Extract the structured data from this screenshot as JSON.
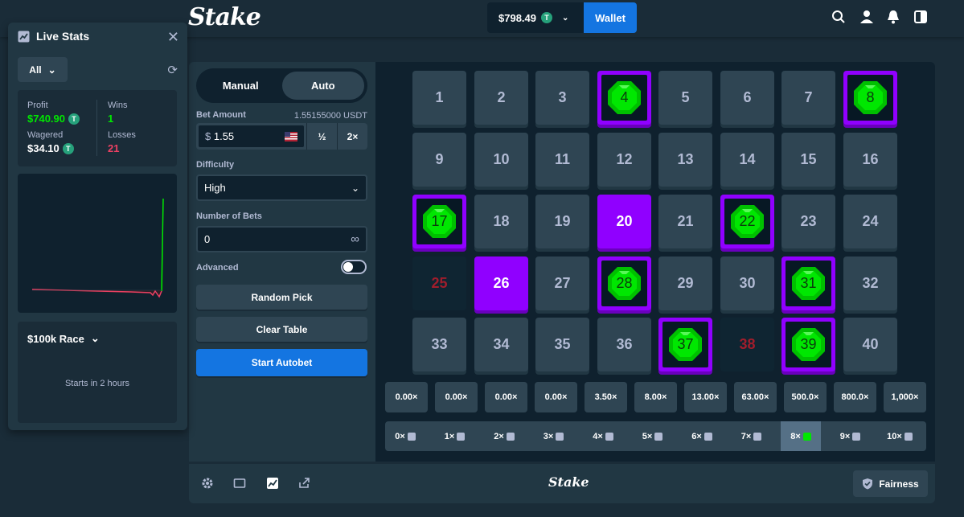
{
  "header": {
    "logo": "Stake",
    "balance": "$798.49",
    "coin": "T",
    "wallet_label": "Wallet",
    "icons": [
      "search-icon",
      "user-icon",
      "notification-icon",
      "sidebar-toggle-icon"
    ]
  },
  "live_stats": {
    "title": "Live Stats",
    "filter": "All",
    "profit_label": "Profit",
    "profit_value": "$740.90",
    "wagered_label": "Wagered",
    "wagered_value": "$34.10",
    "wins_label": "Wins",
    "wins_value": "1",
    "losses_label": "Losses",
    "losses_value": "21",
    "race_title": "$100k Race",
    "race_subtitle": "Starts in 2 hours"
  },
  "controls": {
    "tab_manual": "Manual",
    "tab_auto": "Auto",
    "bet_amount_label": "Bet Amount",
    "bet_amount_crypto": "1.55155000 USDT",
    "bet_currency_symbol": "$",
    "bet_amount_value": "1.55",
    "half_label": "½",
    "double_label": "2×",
    "difficulty_label": "Difficulty",
    "difficulty_value": "High",
    "bets_label": "Number of Bets",
    "bets_value": "0",
    "infinity": "∞",
    "advanced_label": "Advanced",
    "advanced_on": false,
    "random_pick": "Random Pick",
    "clear_table": "Clear Table",
    "start_autobet": "Start Autobet"
  },
  "tiles": [
    {
      "n": "1",
      "state": "idle"
    },
    {
      "n": "2",
      "state": "idle"
    },
    {
      "n": "3",
      "state": "idle"
    },
    {
      "n": "4",
      "state": "gem"
    },
    {
      "n": "5",
      "state": "idle"
    },
    {
      "n": "6",
      "state": "idle"
    },
    {
      "n": "7",
      "state": "idle"
    },
    {
      "n": "8",
      "state": "gem"
    },
    {
      "n": "9",
      "state": "idle"
    },
    {
      "n": "10",
      "state": "idle"
    },
    {
      "n": "11",
      "state": "idle"
    },
    {
      "n": "12",
      "state": "idle"
    },
    {
      "n": "13",
      "state": "idle"
    },
    {
      "n": "14",
      "state": "idle"
    },
    {
      "n": "15",
      "state": "idle"
    },
    {
      "n": "16",
      "state": "idle"
    },
    {
      "n": "17",
      "state": "gem"
    },
    {
      "n": "18",
      "state": "idle"
    },
    {
      "n": "19",
      "state": "idle"
    },
    {
      "n": "20",
      "state": "picked"
    },
    {
      "n": "21",
      "state": "idle"
    },
    {
      "n": "22",
      "state": "gem"
    },
    {
      "n": "23",
      "state": "idle"
    },
    {
      "n": "24",
      "state": "idle"
    },
    {
      "n": "25",
      "state": "miss"
    },
    {
      "n": "26",
      "state": "picked"
    },
    {
      "n": "27",
      "state": "idle"
    },
    {
      "n": "28",
      "state": "gem"
    },
    {
      "n": "29",
      "state": "idle"
    },
    {
      "n": "30",
      "state": "idle"
    },
    {
      "n": "31",
      "state": "gem"
    },
    {
      "n": "32",
      "state": "idle"
    },
    {
      "n": "33",
      "state": "idle"
    },
    {
      "n": "34",
      "state": "idle"
    },
    {
      "n": "35",
      "state": "idle"
    },
    {
      "n": "36",
      "state": "idle"
    },
    {
      "n": "37",
      "state": "gem"
    },
    {
      "n": "38",
      "state": "miss"
    },
    {
      "n": "39",
      "state": "gem"
    },
    {
      "n": "40",
      "state": "idle"
    }
  ],
  "multipliers": [
    "0.00×",
    "0.00×",
    "0.00×",
    "0.00×",
    "3.50×",
    "8.00×",
    "13.00×",
    "63.00×",
    "500.0×",
    "800.0×",
    "1,000×"
  ],
  "hits": [
    "0×",
    "1×",
    "2×",
    "3×",
    "4×",
    "5×",
    "6×",
    "7×",
    "8×",
    "9×",
    "10×"
  ],
  "active_hit": 8,
  "footer": {
    "logo": "Stake",
    "fairness_label": "Fairness"
  },
  "colors": {
    "background": "#1a2c38",
    "panel": "#213743",
    "accent_blue": "#1475e1",
    "picked_purple": "#9000ff",
    "gem_green": "#00e701",
    "profit_green": "#00e701",
    "loss_red": "#ed4163"
  }
}
